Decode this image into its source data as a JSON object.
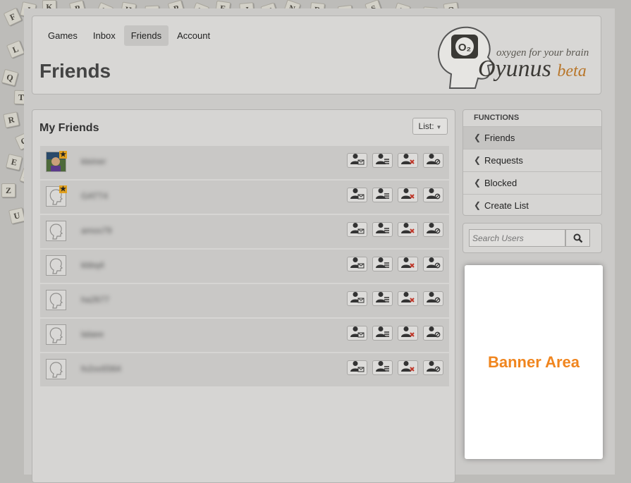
{
  "nav": {
    "games": "Games",
    "inbox": "Inbox",
    "friends": "Friends",
    "account": "Account"
  },
  "page_title": "Friends",
  "logo": {
    "tagline": "oxygen for your brain",
    "name": "Oyunus",
    "beta": "beta",
    "badge": "O₂"
  },
  "friends": {
    "title": "My Friends",
    "list_button": "List:",
    "rows": [
      {
        "username": "kleiner",
        "avatar": "photo",
        "starred": true
      },
      {
        "username": "GATT4",
        "avatar": "default",
        "starred": true
      },
      {
        "username": "amoo79",
        "avatar": "default",
        "starred": false
      },
      {
        "username": "kbbq4",
        "avatar": "default",
        "starred": false
      },
      {
        "username": "ha2677",
        "avatar": "default",
        "starred": false
      },
      {
        "username": "lalaee",
        "avatar": "default",
        "starred": false
      },
      {
        "username": "fo2oo5564",
        "avatar": "default",
        "starred": false
      }
    ]
  },
  "functions": {
    "header": "FUNCTIONS",
    "items": [
      "Friends",
      "Requests",
      "Blocked",
      "Create List"
    ]
  },
  "search": {
    "placeholder": "Search Users"
  },
  "banner": {
    "label": "Banner Area",
    "color": "#f0851e"
  }
}
